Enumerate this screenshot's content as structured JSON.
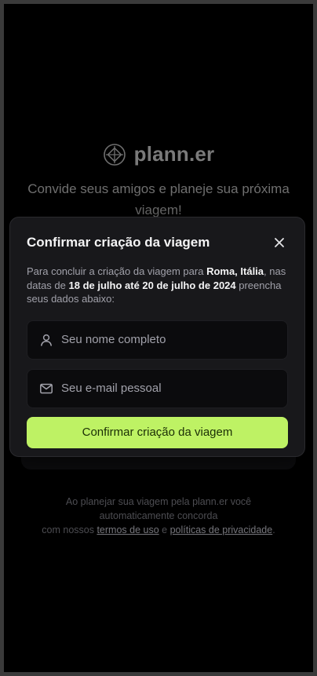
{
  "app": {
    "logo_text": "plann.er",
    "tagline": "Convide seus amigos e planeje sua próxima viagem!"
  },
  "modal": {
    "title": "Confirmar criação da viagem",
    "desc_prefix": "Para concluir a criação da viagem para ",
    "destination": "Roma, Itália",
    "desc_middle": ", nas datas de ",
    "dates": "18 de julho até 20 de julho de 2024",
    "desc_suffix": " preencha seus dados abaixo:",
    "name_placeholder": "Seu nome completo",
    "email_placeholder": "Seu e-mail pessoal",
    "confirm_label": "Confirmar criação da viagem"
  },
  "footer": {
    "line1": "Ao planejar sua viagem pela plann.er você",
    "line2": "automaticamente concorda",
    "line3_prefix": "com nossos ",
    "terms_link": "termos de uso",
    "conjunction": " e ",
    "privacy_link": "políticas de privacidade",
    "line3_suffix": "."
  },
  "colors": {
    "accent": "#bef264",
    "modal_bg": "#18181b",
    "background": "#000000"
  },
  "icons": [
    "globe-logo-icon",
    "close-icon",
    "user-icon",
    "mail-icon"
  ]
}
